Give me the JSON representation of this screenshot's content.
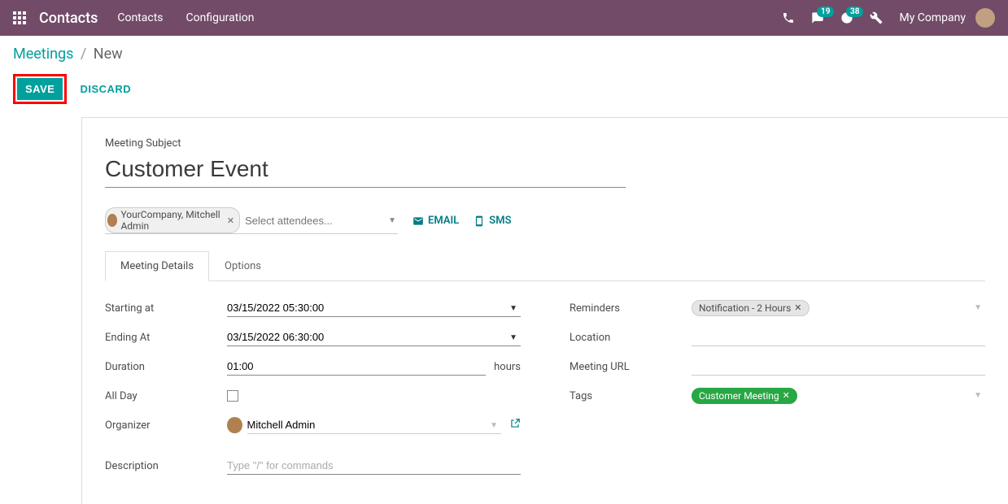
{
  "header": {
    "app_name": "Contacts",
    "nav": [
      "Contacts",
      "Configuration"
    ],
    "messages_badge": "19",
    "activities_badge": "38",
    "company": "My Company"
  },
  "breadcrumb": {
    "parent": "Meetings",
    "current": "New"
  },
  "actions": {
    "save": "SAVE",
    "discard": "DISCARD"
  },
  "form": {
    "subject_label": "Meeting Subject",
    "subject_value": "Customer Event",
    "attendees": {
      "chip": "YourCompany, Mitchell Admin",
      "placeholder": "Select attendees..."
    },
    "email_btn": "EMAIL",
    "sms_btn": "SMS",
    "tabs": [
      "Meeting Details",
      "Options"
    ],
    "labels": {
      "starting_at": "Starting at",
      "ending_at": "Ending At",
      "duration": "Duration",
      "duration_suffix": "hours",
      "all_day": "All Day",
      "organizer": "Organizer",
      "description": "Description",
      "reminders": "Reminders",
      "location": "Location",
      "meeting_url": "Meeting URL",
      "tags": "Tags"
    },
    "values": {
      "starting_at": "03/15/2022 05:30:00",
      "ending_at": "03/15/2022 06:30:00",
      "duration": "01:00",
      "organizer": "Mitchell Admin",
      "reminder_chip": "Notification - 2 Hours",
      "tag_chip": "Customer Meeting",
      "description_placeholder": "Type \"/\" for commands"
    }
  }
}
